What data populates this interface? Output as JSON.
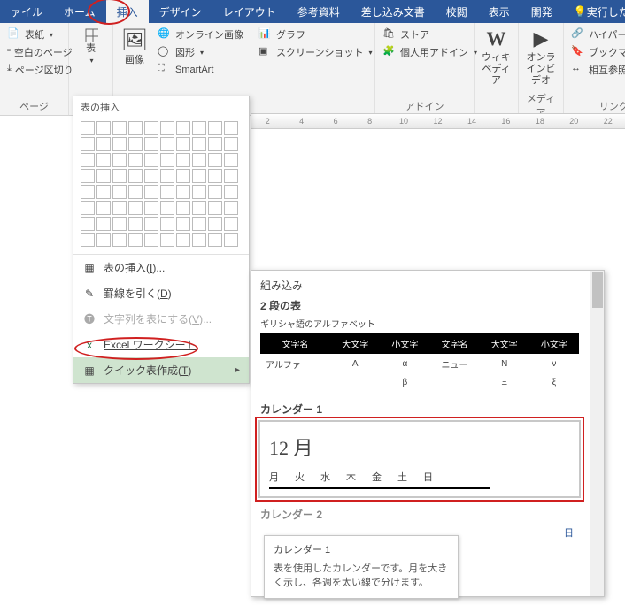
{
  "tabs": {
    "file": "ァイル",
    "home": "ホーム",
    "insert": "挿入",
    "design": "デザイン",
    "layout": "レイアウト",
    "references": "参考資料",
    "mailings": "差し込み文書",
    "review": "校閲",
    "view": "表示",
    "developer": "開発",
    "tell_me": "実行したい"
  },
  "ribbon": {
    "pages": {
      "cover": "表紙",
      "blank": "空白のページ",
      "break": "ページ区切り",
      "group": "ページ"
    },
    "table": {
      "label": "表"
    },
    "image": {
      "label": "画像"
    },
    "illustrations": {
      "online_image": "オンライン画像",
      "shapes": "図形",
      "smartart": "SmartArt"
    },
    "chart": {
      "label": "グラフ"
    },
    "screenshot": {
      "label": "スクリーンショット"
    },
    "store": {
      "label": "ストア"
    },
    "myaddins": {
      "label": "個人用アドイン",
      "group": "アドイン"
    },
    "wikipedia": {
      "label": "ウィキペディア"
    },
    "online_video": {
      "label": "オンラインビデオ",
      "group": "メディア"
    },
    "links": {
      "hyperlink": "ハイパーリンク",
      "bookmark": "ブックマーク",
      "crossref": "相互参照",
      "group": "リンク"
    }
  },
  "table_menu": {
    "title": "表の挿入",
    "insert_table": "表の挿入(I)...",
    "draw_table": "罫線を引く(D)",
    "convert_text": "文字列を表にする(V)...",
    "excel": "Excel ワークシート",
    "quick": "クイック表作成(T)"
  },
  "quick_tables": {
    "builtin": "組み込み",
    "double_table": "2 段の表",
    "greek_caption": "ギリシャ語のアルファベット",
    "greek_headers": [
      "文字名",
      "大文字",
      "小文字",
      "文字名",
      "大文字",
      "小文字"
    ],
    "greek_rows": [
      [
        "アルファ",
        "A",
        "α",
        "ニュー",
        "N",
        "ν"
      ],
      [
        "",
        "",
        "β",
        "",
        "Ξ",
        "ξ"
      ]
    ],
    "calendar1_label": "カレンダー 1",
    "cal_title": "12 月",
    "cal_days": [
      "月",
      "火",
      "水",
      "木",
      "金",
      "土",
      "日"
    ],
    "calendar2_label": "カレンダー 2",
    "stray_day": "日"
  },
  "tooltip": {
    "title": "カレンダー 1",
    "body": "表を使用したカレンダーです。月を大きく示し、各週を太い線で分けます。"
  },
  "ruler_marks": [
    "2",
    "4",
    "6",
    "8",
    "10",
    "12",
    "14",
    "16",
    "18",
    "20",
    "22"
  ]
}
